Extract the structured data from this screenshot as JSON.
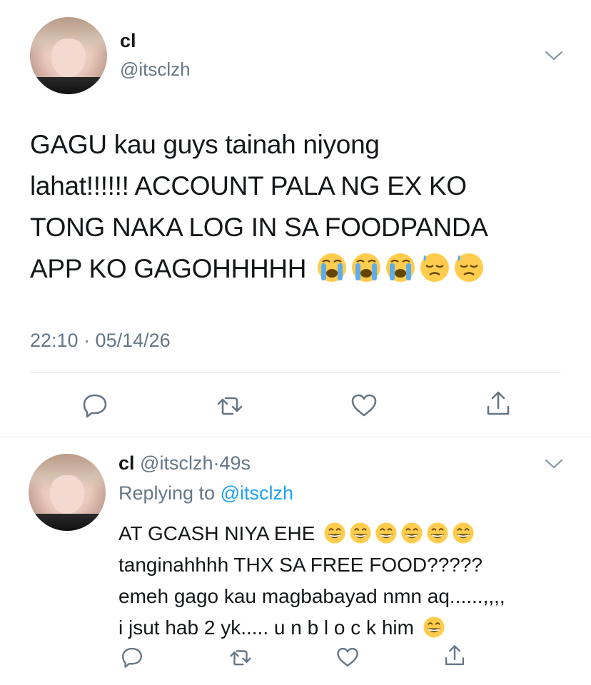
{
  "main_tweet": {
    "display_name": "cl",
    "handle": "@itsclzh",
    "text_lines": [
      "GAGU kau guys tainah niyong",
      "lahat!!!!!! ACCOUNT PALA NG EX KO",
      "TONG NAKA LOG IN SA FOODPANDA",
      "APP KO GAGOHHHHH"
    ],
    "emojis": [
      "crying-face",
      "crying-face",
      "crying-face",
      "downcast-sweat-face",
      "downcast-sweat-face"
    ],
    "timestamp": "22:10 · 05/14/26"
  },
  "reply_tweet": {
    "display_name": "cl",
    "handle": "@itsclzh",
    "separator": "·",
    "age": "49s",
    "replying_prefix": "Replying to",
    "replying_to": "@itsclzh",
    "text_lines": [
      "AT GCASH NIYA EHE",
      "tanginahhhh THX SA FREE FOOD?????",
      "emeh gago kau magbabayad nmn aq......,,,,",
      "i jsut hab 2 yk..... u n b l o c k him"
    ],
    "line1_emojis": [
      "grinning-face",
      "grinning-face",
      "grinning-face",
      "grinning-face",
      "grinning-face",
      "grinning-face"
    ],
    "line4_emoji": "grinning-face"
  },
  "colors": {
    "text": "#14171a",
    "secondary": "#657786",
    "link": "#1da1f2",
    "divider": "#e1e8ed"
  },
  "icons": [
    "reply-icon",
    "retweet-icon",
    "like-icon",
    "share-icon",
    "chevron-down-icon"
  ]
}
